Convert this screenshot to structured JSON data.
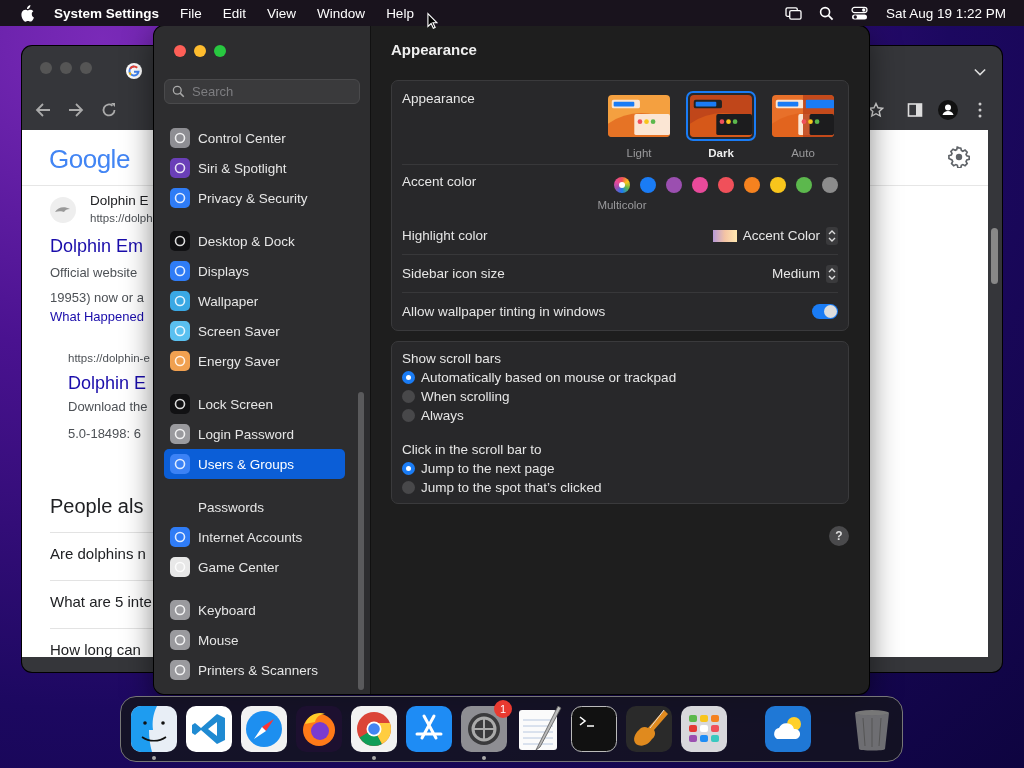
{
  "menu_bar": {
    "app_name": "System Settings",
    "menus": [
      "File",
      "Edit",
      "View",
      "Window",
      "Help"
    ],
    "clock": "Sat Aug 19  1:22 PM"
  },
  "browser": {
    "logo": "Google",
    "result_site": "Dolphin E",
    "result_url": "https://dolph",
    "result_title": "Dolphin Em",
    "snippet_lines": [
      "Official website",
      "19953) now or a"
    ],
    "sublink": "What Happened",
    "sub_url": "https://dolphin-e",
    "sub_title": "Dolphin E",
    "sub_lines": [
      "Download the",
      "5.0-18498: 6"
    ],
    "people_heading": "People als",
    "questions": [
      "Are dolphins n",
      "What are 5 inte",
      "How long can"
    ]
  },
  "sidebar": {
    "search": {
      "placeholder": "Search"
    },
    "groups": [
      {
        "items": [
          {
            "label": "Control Center",
            "selected": false,
            "color": "#8e8e93"
          },
          {
            "label": "Siri & Spotlight",
            "selected": false,
            "color": "#6a3fb8"
          },
          {
            "label": "Privacy & Security",
            "selected": false,
            "color": "#2f7cf6"
          }
        ]
      },
      {
        "items": [
          {
            "label": "Desktop & Dock",
            "selected": false,
            "color": "#111113"
          },
          {
            "label": "Displays",
            "selected": false,
            "color": "#2f7cf6"
          },
          {
            "label": "Wallpaper",
            "selected": false,
            "color": "#3aa8e4"
          },
          {
            "label": "Screen Saver",
            "selected": false,
            "color": "#5ac0f0"
          },
          {
            "label": "Energy Saver",
            "selected": false,
            "color": "#f0a050"
          }
        ]
      },
      {
        "items": [
          {
            "label": "Lock Screen",
            "selected": false,
            "color": "#111113"
          },
          {
            "label": "Login Password",
            "selected": false,
            "color": "#9a9a9e"
          },
          {
            "label": "Users & Groups",
            "selected": true,
            "color": "#3b82f6"
          }
        ]
      },
      {
        "items": [
          {
            "label": "Passwords",
            "selected": false
          },
          {
            "label": "Internet Accounts",
            "selected": false,
            "color": "#2f7cf6"
          },
          {
            "label": "Game Center",
            "selected": false,
            "color": "#e8e8e8"
          }
        ]
      },
      {
        "items": [
          {
            "label": "Keyboard",
            "selected": false,
            "color": "#9a9a9e"
          },
          {
            "label": "Mouse",
            "selected": false,
            "color": "#9a9a9e"
          },
          {
            "label": "Printers & Scanners",
            "selected": false,
            "color": "#9a9a9e"
          }
        ]
      }
    ]
  },
  "content": {
    "title": "Appearance",
    "appearance": {
      "label": "Appearance",
      "options": [
        {
          "label": "Light",
          "kind": "light",
          "selected": false
        },
        {
          "label": "Dark",
          "kind": "dark",
          "selected": true
        },
        {
          "label": "Auto",
          "kind": "auto",
          "selected": false
        }
      ]
    },
    "accent": {
      "label": "Accent color",
      "swatches": [
        {
          "kind": "multicolor",
          "label": "Multicolor",
          "selected": true
        },
        {
          "kind": "solid",
          "color": "#1a7cf5",
          "selected": false
        },
        {
          "kind": "solid",
          "color": "#9b4fb0",
          "selected": false
        },
        {
          "kind": "solid",
          "color": "#e84a9a",
          "selected": false
        },
        {
          "kind": "solid",
          "color": "#f0505a",
          "selected": false
        },
        {
          "kind": "solid",
          "color": "#f5821f",
          "selected": false
        },
        {
          "kind": "solid",
          "color": "#f8c51c",
          "selected": false
        },
        {
          "kind": "solid",
          "color": "#5cb84d",
          "selected": false
        },
        {
          "kind": "solid",
          "color": "#8c8c8c",
          "selected": false
        }
      ]
    },
    "highlight": {
      "label": "Highlight color",
      "value": "Accent Color"
    },
    "icon_size": {
      "label": "Sidebar icon size",
      "value": "Medium"
    },
    "tinting": {
      "label": "Allow wallpaper tinting in windows",
      "on": true
    },
    "scroll_groups": [
      {
        "label": "Show scroll bars",
        "options": [
          {
            "label": "Automatically based on mouse or trackpad",
            "selected": true
          },
          {
            "label": "When scrolling",
            "selected": false
          },
          {
            "label": "Always",
            "selected": false
          }
        ]
      },
      {
        "label": "Click in the scroll bar to",
        "options": [
          {
            "label": "Jump to the next page",
            "selected": true
          },
          {
            "label": "Jump to the spot that’s clicked",
            "selected": false
          }
        ]
      }
    ],
    "help": "?"
  },
  "dock": {
    "items": [
      {
        "running": true
      },
      {
        "running": false
      },
      {
        "running": false
      },
      {
        "running": false
      },
      {
        "running": true
      },
      {
        "running": false
      },
      {
        "running": true,
        "badge": "1"
      },
      {
        "running": false
      },
      {
        "running": false
      },
      {
        "running": false
      },
      {
        "running": false
      },
      {
        "running": false
      },
      {
        "running": false
      }
    ]
  }
}
